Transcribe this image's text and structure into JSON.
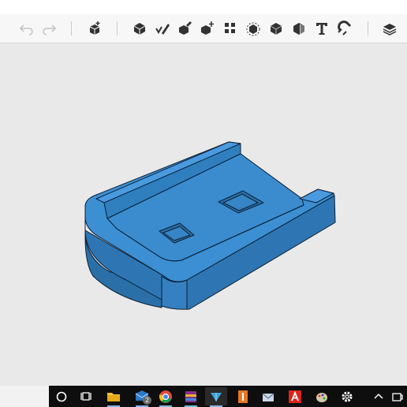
{
  "toolbar": {
    "undo": {
      "icon": "undo-arrow-icon"
    },
    "redo": {
      "icon": "redo-arrow-icon"
    },
    "tools": [
      {
        "icon": "insert-component-icon"
      },
      {
        "icon": "box-solid-icon"
      },
      {
        "icon": "sketch-pencil-icon"
      },
      {
        "icon": "edit-pencil-solid-icon"
      },
      {
        "icon": "move-solid-icon"
      },
      {
        "icon": "pattern-grid-icon"
      },
      {
        "icon": "select-target-icon"
      },
      {
        "icon": "solid-cube-icon"
      },
      {
        "icon": "section-cube-icon"
      },
      {
        "icon": "text-icon",
        "glyph": "T"
      },
      {
        "icon": "magnet-snap-icon"
      },
      {
        "icon": "layers-stack-icon"
      }
    ]
  },
  "model": {
    "color": "#3b8fd2",
    "shade_top": "#3b8fd2",
    "shade_front": "#2e76b3",
    "shade_side": "#1f5a8e",
    "edge_color": "#0c1f33"
  },
  "taskbar": {
    "search_icon": "circle-search-icon",
    "task_view_icon": "task-view-icon",
    "apps": [
      {
        "icon": "file-explorer-icon"
      },
      {
        "icon": "mail-icon",
        "badge": "2"
      },
      {
        "icon": "chrome-browser-icon"
      },
      {
        "icon": "archive-app-icon"
      },
      {
        "icon": "cad-app-icon",
        "active": true
      },
      {
        "icon": "orange-app-icon"
      },
      {
        "icon": "mail-client-icon"
      },
      {
        "icon": "acrobat-icon"
      },
      {
        "icon": "paint-app-icon"
      },
      {
        "icon": "settings-gear-icon"
      }
    ],
    "tray": [
      "chevron-up-icon",
      "tray-app-icon"
    ]
  }
}
